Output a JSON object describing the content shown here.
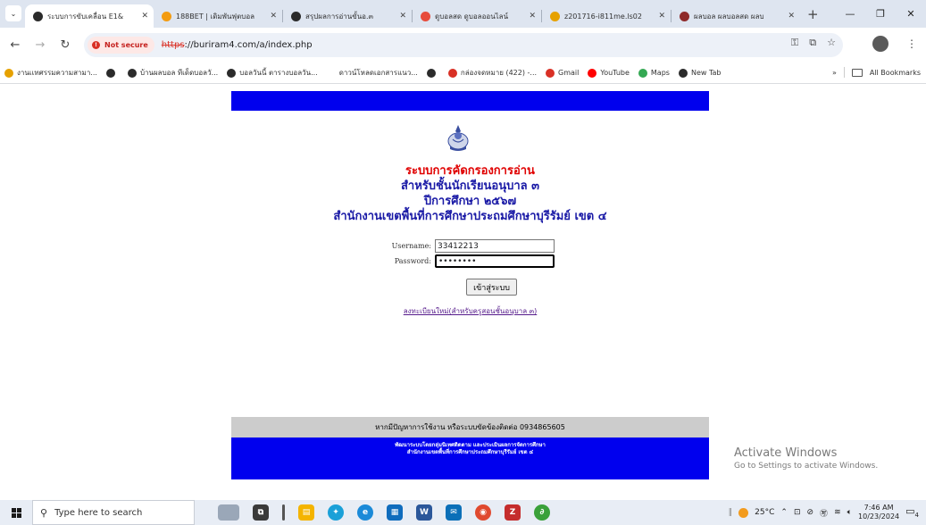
{
  "browser": {
    "tabs": [
      {
        "title": "ระบบการขับเคลื่อน E1&",
        "active": true,
        "favicon_color": "#2b2b2b",
        "favicon": "globe-icon"
      },
      {
        "title": "188BET | เดิมพันฟุตบอล",
        "active": false,
        "favicon_color": "#f39c12",
        "favicon": "bet-icon"
      },
      {
        "title": "สรุปผลการอ่านขั้นอ.๓",
        "active": false,
        "favicon_color": "#2b2b2b",
        "favicon": "globe-icon"
      },
      {
        "title": "ดูบอลสด ดูบอลออนไลน์",
        "active": false,
        "favicon_color": "#e74c3c",
        "favicon": "ball-icon"
      },
      {
        "title": "z201716-i811me.ls02",
        "active": false,
        "favicon_color": "#e6a100",
        "favicon": "crown-icon"
      },
      {
        "title": "ผลบอล ผลบอลสด ผลบ",
        "active": false,
        "favicon_color": "#8e2a2a",
        "favicon": "ball-icon"
      }
    ],
    "address": {
      "security_label": "Not secure",
      "url_scheme": "https",
      "url_rest": "://buriram4.com/a/index.php"
    },
    "bookmarks": [
      {
        "label": "งานเเทศรรมความสามา...",
        "color": "#e6a100"
      },
      {
        "label": "",
        "color": "#2b2b2b"
      },
      {
        "label": "บ้านผลบอล ทีเด็ดบอลวั...",
        "color": "#2b2b2b"
      },
      {
        "label": "บอลวันนี้ ตารางบอลวัน...",
        "color": "#2b2b2b"
      },
      {
        "label": "ดาวน์โหลดเอกสารแนว...",
        "color": "#ffffff"
      },
      {
        "label": "",
        "color": "#2b2b2b"
      },
      {
        "label": "กล่องจดหมาย (422) -...",
        "color": "#d93025"
      },
      {
        "label": "Gmail",
        "color": "#d93025"
      },
      {
        "label": "YouTube",
        "color": "#ff0000"
      },
      {
        "label": "Maps",
        "color": "#34a853"
      },
      {
        "label": "New Tab",
        "color": "#2b2b2b"
      }
    ],
    "all_bookmarks": "All Bookmarks",
    "more_bookmarks": "»"
  },
  "page": {
    "title_line1": "ระบบการคัดกรองการอ่าน",
    "title_line2": "สำหรับชั้นนักเรียนอนุบาล ๓",
    "title_line3": "ปีการศึกษา ๒๕๖๗",
    "title_line4": "สำนักงานเขตพื้นที่การศึกษาประถมศึกษาบุรีรัมย์ เขต ๔",
    "username_label": "Username:",
    "username_value": "33412213",
    "password_label": "Password:",
    "password_value": "••••••••",
    "login_button": "เข้าสู่ระบบ",
    "register_link": "ลงทะเบียนใหม่(สำหรับครูสอนชั้นอนุบาล ๓)",
    "help_text": "หากมีปัญหาการใช้งาน หรือระบบขัดข้องติดต่อ 0934865605",
    "footer_line1": "พัฒนาระบบโดยกลุ่มนิเทศติดตาม และประเมินผลการจัดการศึกษา",
    "footer_line2": "สำนักงานเขตพื้นที่การศึกษาประถมศึกษาบุรีรัมย์ เขต ๔"
  },
  "activate": {
    "line1": "Activate Windows",
    "line2": "Go to Settings to activate Windows."
  },
  "taskbar": {
    "search_placeholder": "Type here to search",
    "temperature": "25°C",
    "time": "7:46 AM",
    "date": "10/23/2024",
    "notif_count": "4"
  },
  "colors": {
    "banner_blue": "#0000ee",
    "title_red": "#e00000",
    "title_blue": "#1a1aa6"
  }
}
